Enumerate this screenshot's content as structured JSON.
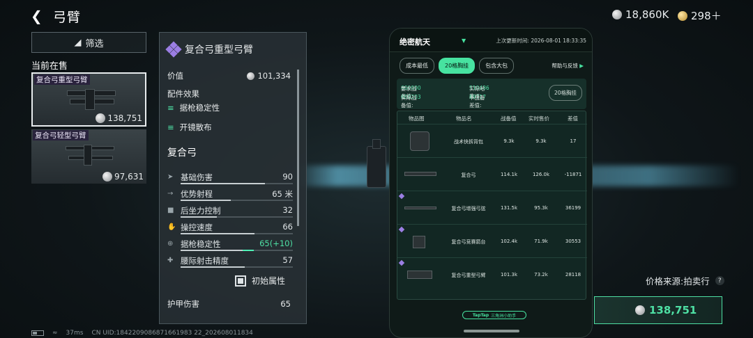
{
  "header": {
    "title": "弓臂",
    "currency_silver": "18,860K",
    "currency_gold": "298＋"
  },
  "filter": {
    "label": "筛选"
  },
  "on_sale": {
    "label": "当前在售"
  },
  "items": [
    {
      "name": "复合弓重型弓臂",
      "price": "138,751"
    },
    {
      "name": "复合弓轻型弓臂",
      "price": "97,631"
    }
  ],
  "detail": {
    "name": "复合弓重型弓臂",
    "value_label": "价值",
    "value": "101,334",
    "effects_label": "配件效果",
    "effects": [
      "据枪稳定性",
      "开镜散布"
    ],
    "weapon": "复合弓",
    "stats": [
      {
        "label": "基础伤害",
        "value": "90",
        "level": 0.75
      },
      {
        "label": "优势射程",
        "value": "65 米",
        "level": 0.45
      },
      {
        "label": "后坐力控制",
        "value": "32",
        "level": 0.32
      },
      {
        "label": "操控速度",
        "value": "66",
        "level": 0.66
      },
      {
        "label": "据枪稳定性",
        "value": "65(+10)",
        "level": 0.55,
        "bonus": 0.1
      },
      {
        "label": "腰际射击精度",
        "value": "57",
        "level": 0.57
      }
    ],
    "initial_attr": "初始属性",
    "armor_label": "护甲伤害",
    "armor_value": "65"
  },
  "phone": {
    "title": "绝密航天",
    "updated": "上次更新时间: 2026-08-01 18:33:35",
    "tabs": [
      "成本最低",
      "20格胸挂",
      "包含大包"
    ],
    "active_tab": 1,
    "help": "帮助与反馈",
    "summary": {
      "req_label": "要求战备值:",
      "req_value": "600000",
      "actual_label": "实际战备值:",
      "actual_value": "600203",
      "hafcoin_label": "实际哈弗币:",
      "hafcoin_value": "510486",
      "diff_label": "卡战备差值:",
      "diff_value": "89717",
      "button": "20格胸挂"
    },
    "table": {
      "headers": [
        "物品图",
        "物品名",
        "战备值",
        "实时售价",
        "差值"
      ],
      "rows": [
        {
          "name": "战术快拆背包",
          "value": "9.3k",
          "price": "9.3k",
          "diff": "17"
        },
        {
          "name": "复合弓",
          "value": "114.1k",
          "price": "126.0k",
          "diff": "-11871"
        },
        {
          "name": "复合弓增强弓弦",
          "value": "131.5k",
          "price": "95.3k",
          "diff": "36199"
        },
        {
          "name": "复合弓竞赛箭台",
          "value": "102.4k",
          "price": "71.9k",
          "diff": "30553"
        },
        {
          "name": "复合弓重型弓臂",
          "value": "101.3k",
          "price": "73.2k",
          "diff": "28118"
        }
      ]
    },
    "footer": {
      "brand": "TapTap",
      "sub": "三角洲小助手"
    }
  },
  "price_source": "价格来源:拍卖行",
  "buy": {
    "price": "138,751"
  },
  "status": {
    "ping": "37ms",
    "uid": "CN UID:1842209086871661983 22_202608011834"
  },
  "colors": {
    "accent": "#4ee0a4",
    "rarity": "#9b7ee3"
  }
}
